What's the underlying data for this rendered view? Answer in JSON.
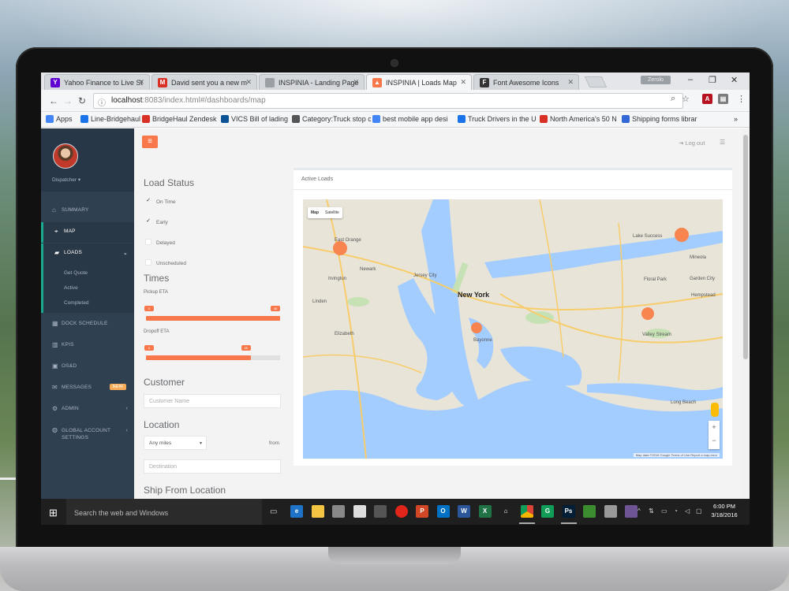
{
  "browser": {
    "tabs": [
      {
        "label": "Yahoo Finance to Live St",
        "icon": "yahoo-icon",
        "color": "#6001d2",
        "glyph": "Y"
      },
      {
        "label": "David sent you a new m",
        "icon": "gmail-icon",
        "color": "#d93025",
        "glyph": "M"
      },
      {
        "label": "INSPINIA - Landing Page",
        "icon": "page-icon",
        "color": "#9aa0a6",
        "glyph": ""
      },
      {
        "label": "INSPINIA | Loads Map",
        "icon": "inspinia-icon",
        "color": "#f8784b",
        "glyph": "▲"
      },
      {
        "label": "Font Awesome Icons",
        "icon": "fontawesome-icon",
        "color": "#333333",
        "glyph": "F"
      }
    ],
    "profile_pill": "Zerolo",
    "url_host": "localhost",
    "url_path": ":8083/index.html#/dashboards/map"
  },
  "bookmarks": [
    {
      "label": "Apps",
      "color": "#4285f4"
    },
    {
      "label": "Line-Bridgehaul",
      "color": "#1a73e8"
    },
    {
      "label": "BridgeHaul Zendesk",
      "color": "#d93025"
    },
    {
      "label": "VICS Bill of lading",
      "color": "#0b5394"
    },
    {
      "label": "Category:Truck stop c",
      "color": "#555555"
    },
    {
      "label": "best mobile app desi",
      "color": "#4285f4"
    },
    {
      "label": "Truck Drivers in the U",
      "color": "#1a73e8"
    },
    {
      "label": "North America's 50 N",
      "color": "#d93025"
    },
    {
      "label": "Shipping forms librar",
      "color": "#3367d6"
    }
  ],
  "sidebar": {
    "user": "Dispatcher",
    "items": [
      {
        "label": "SUMMARY",
        "icon": "home-icon"
      },
      {
        "label": "MAP",
        "icon": "map-marker-icon"
      },
      {
        "label": "LOADS",
        "icon": "truck-icon"
      },
      {
        "label": "DOCK SCHEDULE",
        "icon": "calendar-icon"
      },
      {
        "label": "KPIs",
        "icon": "chart-icon"
      },
      {
        "label": "OS&D",
        "icon": "box-icon"
      },
      {
        "label": "MESSAGES",
        "icon": "envelope-icon",
        "badge": "NEW"
      },
      {
        "label": "ADMIN",
        "icon": "gear-icon"
      },
      {
        "label": "GLOBAL ACCOUNT SETTINGS",
        "icon": "globe-icon"
      }
    ],
    "sub_items": [
      "Get Quote",
      "Active",
      "Completed"
    ]
  },
  "topbar": {
    "logout": "Log out"
  },
  "filters": {
    "load_status_title": "Load Status",
    "statuses": [
      {
        "label": "On Time",
        "checked": true
      },
      {
        "label": "Early",
        "checked": true
      },
      {
        "label": "Delayed",
        "checked": false
      },
      {
        "label": "Unscheduled",
        "checked": false
      }
    ],
    "times_title": "Times",
    "pickup_label": "Pickup ETA",
    "pickup_range": [
      0,
      1
    ],
    "dropoff_label": "Dropoff ETA",
    "dropoff_range": [
      0,
      0.78
    ],
    "customer_title": "Customer",
    "customer_placeholder": "Customer Name",
    "location_title": "Location",
    "miles_value": "Any miles",
    "from_label": "from",
    "destination_placeholder": "Destination",
    "ship_from_title": "Ship From Location"
  },
  "loads": {
    "title": "Active Loads",
    "map_types": [
      "Map",
      "Satellite"
    ],
    "map_labels": [
      {
        "text": "New York"
      },
      {
        "text": "Jersey City"
      },
      {
        "text": "Newark"
      },
      {
        "text": "East Orange"
      },
      {
        "text": "Irvington"
      },
      {
        "text": "Elizabeth"
      },
      {
        "text": "Linden"
      },
      {
        "text": "Lake Success"
      },
      {
        "text": "Mineola"
      },
      {
        "text": "Floral Park"
      },
      {
        "text": "Hempstead"
      },
      {
        "text": "Valley Stream"
      },
      {
        "text": "Long Beach"
      },
      {
        "text": "Garden City"
      },
      {
        "text": "Bayonne"
      }
    ],
    "map_footer": "Map data ©2016 Google   Terms of Use   Report a map error"
  },
  "taskbar": {
    "search_placeholder": "Search the web and Windows",
    "time": "6:00 PM",
    "date": "3/18/2016",
    "apps": [
      {
        "name": "edge-icon",
        "color": "#1e73c9",
        "glyph": "e"
      },
      {
        "name": "folder-icon",
        "color": "#f4c542",
        "glyph": ""
      },
      {
        "name": "store-icon",
        "color": "#888888",
        "glyph": ""
      },
      {
        "name": "file-icon",
        "color": "#dddddd",
        "glyph": ""
      },
      {
        "name": "tools-icon",
        "color": "#555555",
        "glyph": ""
      },
      {
        "name": "cloud-icon",
        "color": "#e1251b",
        "glyph": ""
      },
      {
        "name": "powerpoint-icon",
        "color": "#d24726",
        "glyph": "P"
      },
      {
        "name": "outlook-icon",
        "color": "#0072c6",
        "glyph": "O"
      },
      {
        "name": "word-icon",
        "color": "#2b579a",
        "glyph": "W"
      },
      {
        "name": "excel-icon",
        "color": "#217346",
        "glyph": "X"
      },
      {
        "name": "home-app-icon",
        "color": "#1f1f1f",
        "glyph": "⌂"
      },
      {
        "name": "chrome-icon",
        "color": "#4285f4",
        "glyph": ""
      },
      {
        "name": "green-app-icon",
        "color": "#0f9d58",
        "glyph": "G"
      },
      {
        "name": "photoshop-icon",
        "color": "#001e36",
        "glyph": "Ps"
      },
      {
        "name": "notepad-icon",
        "color": "#3c8d2f",
        "glyph": ""
      },
      {
        "name": "photo-icon",
        "color": "#999999",
        "glyph": ""
      },
      {
        "name": "github-icon",
        "color": "#6e5494",
        "glyph": ""
      }
    ]
  }
}
